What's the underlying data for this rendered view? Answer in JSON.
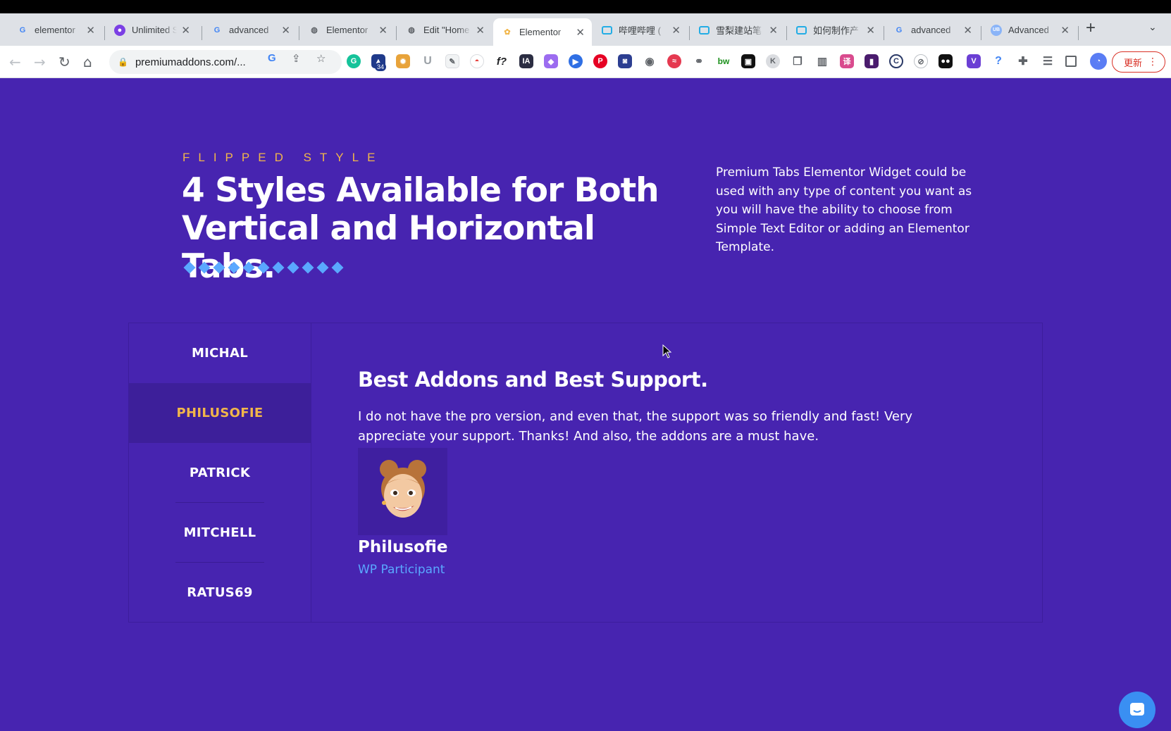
{
  "browser": {
    "tabs": [
      {
        "title": "elementor",
        "favicon": "google-icon"
      },
      {
        "title": "Unlimited S",
        "favicon": "purple-logo-icon"
      },
      {
        "title": "advanced",
        "favicon": "google-icon"
      },
      {
        "title": "Elementor",
        "favicon": "globe-icon"
      },
      {
        "title": "Edit \"Home",
        "favicon": "globe-icon"
      },
      {
        "title": "Elementor",
        "favicon": "premium-addons-icon",
        "active": true
      },
      {
        "title": "哔哩哔哩 (",
        "favicon": "bilibili-icon"
      },
      {
        "title": "雪梨建站笔",
        "favicon": "bilibili-icon"
      },
      {
        "title": "如何制作产",
        "favicon": "bilibili-icon"
      },
      {
        "title": "advanced",
        "favicon": "google-icon"
      },
      {
        "title": "Advanced",
        "favicon": "ub-icon"
      }
    ],
    "close_glyph": "✕",
    "url": "premiumaddons.com/...",
    "extension_badge": "34",
    "update_label": "更新"
  },
  "page": {
    "eyebrow": "FLIPPED STYLE",
    "headline": "4 Styles Available for Both Vertical and Horizontal Tabs.",
    "intro": "Premium Tabs Elementor Widget could be used with any type of content you want as you will have the ability to choose from Simple Text Editor or adding an Elementor Template.",
    "accent_color": "#f1b64a",
    "link_color": "#5aa8ff",
    "background_color": "#4724b0",
    "tab_names": [
      "MICHAL",
      "PHILUSOFIE",
      "PATRICK",
      "MITCHELL",
      "RATUS69"
    ],
    "active_tab": "PHILUSOFIE",
    "panel": {
      "title": "Best Addons and Best Support.",
      "text": "I do not have the pro version, and even that, the support was so friendly and fast! Very appreciate your support. Thanks! And also, the addons are a must have.",
      "name": "Philusofie",
      "role": "WP Participant"
    }
  }
}
